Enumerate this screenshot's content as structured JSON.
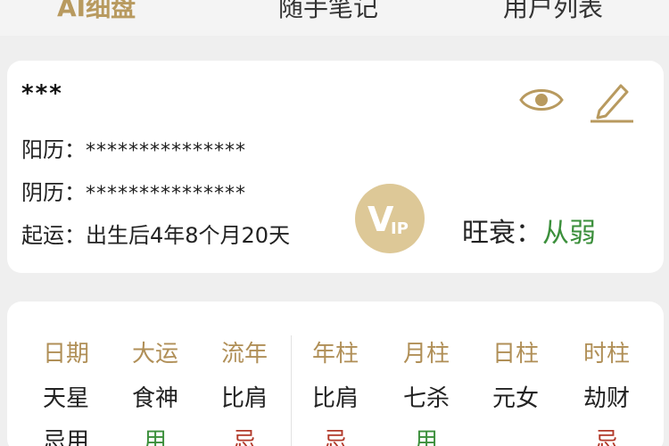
{
  "nav": {
    "tabs": [
      {
        "label": "AI细盘",
        "active": true
      },
      {
        "label": "随手笔记",
        "active": false
      },
      {
        "label": "用户列表",
        "active": false
      }
    ]
  },
  "info": {
    "name": "***",
    "solar_label": "阳历：",
    "solar_value": "***************",
    "lunar_label": "阴历：",
    "lunar_value": "***************",
    "start_label": "起运：",
    "start_value": "出生后4年8个月20天",
    "strength_label": "旺衰：",
    "strength_value": "从弱",
    "vip_v": "V",
    "vip_ip": "IP",
    "icons": [
      "eye-icon",
      "edit-icon"
    ]
  },
  "chart": {
    "columns": [
      {
        "head": "日期",
        "star": "天星",
        "use": "忌用",
        "use_color": "dark"
      },
      {
        "head": "大运",
        "star": "食神",
        "use": "用",
        "use_color": "green"
      },
      {
        "head": "流年",
        "star": "比肩",
        "use": "忌",
        "use_color": "red"
      },
      {
        "head": "年柱",
        "star": "比肩",
        "use": "忌",
        "use_color": "red"
      },
      {
        "head": "月柱",
        "star": "七杀",
        "use": "用",
        "use_color": "green"
      },
      {
        "head": "日柱",
        "star": "元女",
        "use": "",
        "use_color": "dark"
      },
      {
        "head": "时柱",
        "star": "劫财",
        "use": "忌",
        "use_color": "red"
      }
    ]
  },
  "colors": {
    "accent": "#b89a5f",
    "green": "#3b8f3b",
    "red": "#b23a2a"
  }
}
